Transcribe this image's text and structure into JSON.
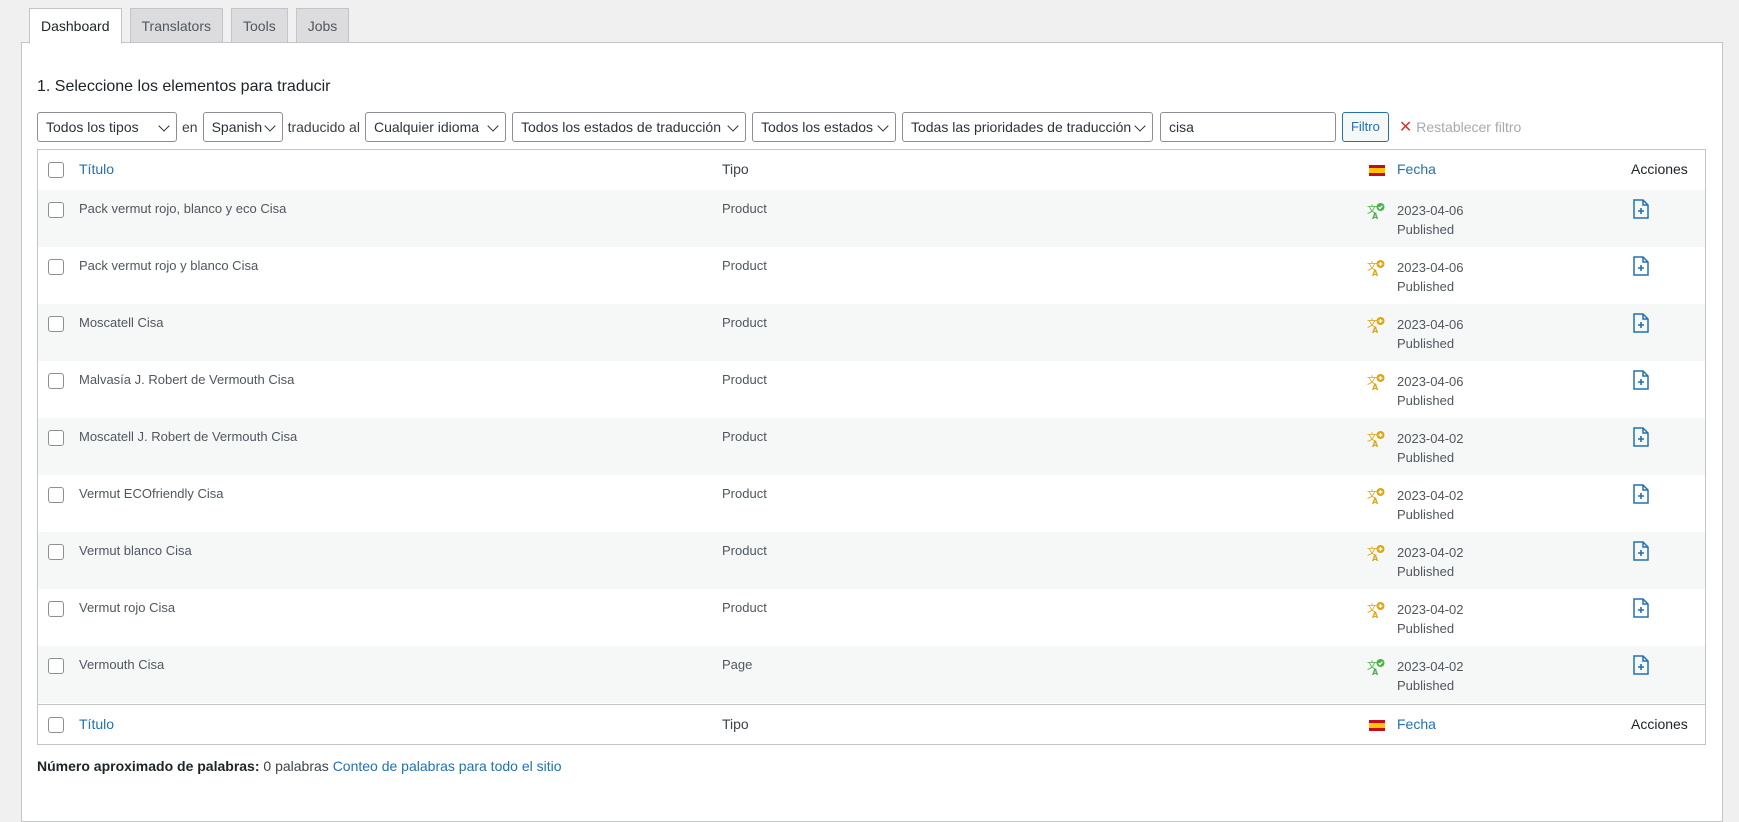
{
  "tabs": [
    "Dashboard",
    "Translators",
    "Tools",
    "Jobs"
  ],
  "section_title": "1. Seleccione los elementos para traducir",
  "filters": {
    "type": "Todos los tipos",
    "en_text": "en",
    "source_lang": "Spanish",
    "translated_text": "traducido al",
    "target_lang": "Cualquier idioma",
    "translation_status": "Todos los estados de traducción",
    "post_status": "Todos los estados",
    "priority": "Todas las prioridades de traducción",
    "search_value": "cisa",
    "filter_button": "Filtro",
    "reset": "Restablecer filtro"
  },
  "table": {
    "columns": {
      "title": "Título",
      "type": "Tipo",
      "date": "Fecha",
      "actions": "Acciones"
    },
    "rows": [
      {
        "title": "Pack vermut rojo, blanco y eco Cisa",
        "type": "Product",
        "status_icon": "translation-complete-icon",
        "date": "2023-04-06",
        "status": "Published"
      },
      {
        "title": "Pack vermut rojo y blanco Cisa",
        "type": "Product",
        "status_icon": "translation-needed-icon",
        "date": "2023-04-06",
        "status": "Published"
      },
      {
        "title": "Moscatell Cisa",
        "type": "Product",
        "status_icon": "translation-needed-icon",
        "date": "2023-04-06",
        "status": "Published"
      },
      {
        "title": "Malvasía J. Robert de Vermouth Cisa",
        "type": "Product",
        "status_icon": "translation-needed-icon",
        "date": "2023-04-06",
        "status": "Published"
      },
      {
        "title": "Moscatell J. Robert de Vermouth Cisa",
        "type": "Product",
        "status_icon": "translation-needed-icon",
        "date": "2023-04-02",
        "status": "Published"
      },
      {
        "title": "Vermut ECOfriendly Cisa",
        "type": "Product",
        "status_icon": "translation-needed-icon",
        "date": "2023-04-02",
        "status": "Published"
      },
      {
        "title": "Vermut blanco Cisa",
        "type": "Product",
        "status_icon": "translation-needed-icon",
        "date": "2023-04-02",
        "status": "Published"
      },
      {
        "title": "Vermut rojo Cisa",
        "type": "Product",
        "status_icon": "translation-needed-icon",
        "date": "2023-04-02",
        "status": "Published"
      },
      {
        "title": "Vermouth Cisa",
        "type": "Page",
        "status_icon": "translation-complete-icon",
        "date": "2023-04-02",
        "status": "Published"
      }
    ]
  },
  "word_count": {
    "label": "Número aproximado de palabras:",
    "value": "0 palabras",
    "link": "Conteo de palabras para todo el sitio"
  },
  "colors": {
    "link": "#2271b1",
    "complete": "#4ab04a",
    "needed": "#dba617",
    "flag_red": "#c60b1e",
    "flag_yellow": "#ffc400"
  }
}
